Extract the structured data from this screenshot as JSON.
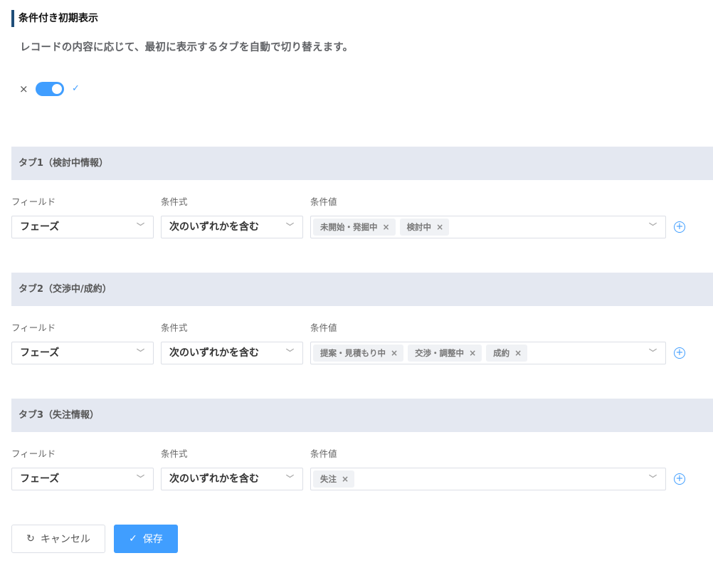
{
  "section": {
    "title": "条件付き初期表示",
    "description": "レコードの内容に応じて、最初に表示するタブを自動で切り替えます。"
  },
  "toggle": {
    "enabled": true,
    "off_glyph": "×",
    "on_glyph": "✓"
  },
  "labels": {
    "field": "フィールド",
    "operator": "条件式",
    "value": "条件値"
  },
  "tabs": [
    {
      "title": "タブ1（検討中情報）",
      "field": "フェーズ",
      "operator": "次のいずれかを含む",
      "values": [
        "未開始・発掘中",
        "検討中"
      ]
    },
    {
      "title": "タブ2（交渉中/成約）",
      "field": "フェーズ",
      "operator": "次のいずれかを含む",
      "values": [
        "提案・見積もり中",
        "交渉・調整中",
        "成約"
      ]
    },
    {
      "title": "タブ3（失注情報）",
      "field": "フェーズ",
      "operator": "次のいずれかを含む",
      "values": [
        "失注"
      ]
    }
  ],
  "buttons": {
    "cancel": "キャンセル",
    "save": "保存"
  },
  "icons": {
    "dropdown": "chevron-down-icon",
    "add": "plus-circle-icon",
    "tag_remove": "close-icon",
    "cancel": "refresh-icon",
    "save": "check-icon"
  },
  "colors": {
    "accent": "#409eff",
    "header_bg": "#e4e8f1",
    "title_bar": "#1f4e79"
  }
}
